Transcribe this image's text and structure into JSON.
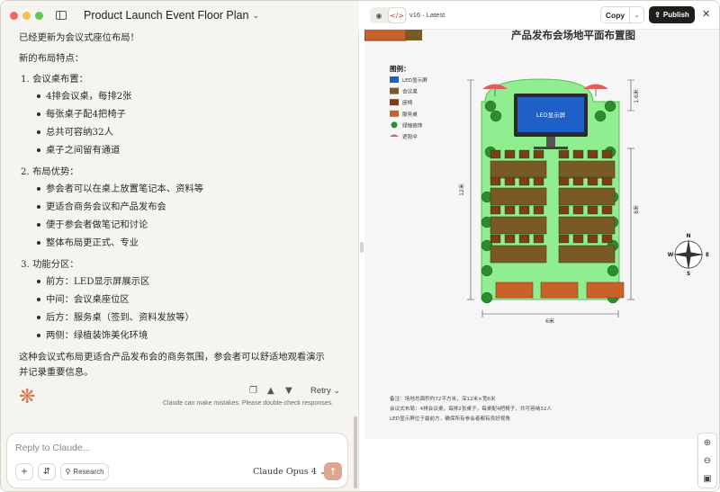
{
  "window": {
    "conversation_title": "Product Launch Event Floor Plan"
  },
  "chat": {
    "lead": "已经更新为会议式座位布局！",
    "subheading": "新的布局特点：",
    "sections": [
      {
        "title": "1. 会议桌布置：",
        "items": [
          "4排会议桌，每排2张",
          "每张桌子配4把椅子",
          "总共可容纳32人",
          "桌子之间留有通道"
        ]
      },
      {
        "title": "2. 布局优势：",
        "items": [
          "参会者可以在桌上放置笔记本、资料等",
          "更适合商务会议和产品发布会",
          "便于参会者做笔记和讨论",
          "整体布局更正式、专业"
        ]
      },
      {
        "title": "3. 功能分区：",
        "items": [
          "前方：LED显示屏展示区",
          "中间：会议桌座位区",
          "后方：服务桌（签到、资料发放等）",
          "两侧：绿植装饰美化环境"
        ]
      }
    ],
    "summary": "这种会议式布局更适合产品发布会的商务氛围，参会者可以舒适地观看演示并记录重要信息。",
    "retry_label": "Retry",
    "disclaimer": "Claude can make mistakes. Please double-check responses."
  },
  "input": {
    "placeholder": "Reply to Claude...",
    "research_label": "Research",
    "model_label": "Claude Opus 4"
  },
  "artifact": {
    "version_label": "v16 · Latest",
    "copy_label": "Copy",
    "publish_label": "Publish",
    "floor_plan": {
      "title": "产品发布会场地平面布置图",
      "legend_title": "图例：",
      "legend": [
        {
          "label": "LED显示屏",
          "color": "#1f5fc8",
          "shape": "rect"
        },
        {
          "label": "会议桌",
          "color": "#7a5a24",
          "shape": "rect"
        },
        {
          "label": "座椅",
          "color": "#7a3e1c",
          "shape": "rect"
        },
        {
          "label": "服务桌",
          "color": "#c8622a",
          "shape": "rect"
        },
        {
          "label": "绿植装饰",
          "color": "#2e8b2e",
          "shape": "circle"
        },
        {
          "label": "遮阳伞",
          "color": "#e25c5c",
          "shape": "umbrella"
        }
      ],
      "led_label": "LED显示屏",
      "dim_height_total": "12米",
      "dim_width": "6米",
      "dim_top": "1.6米",
      "dim_mid": "8米",
      "compass": {
        "n": "N",
        "s": "S",
        "e": "E",
        "w": "W"
      },
      "notes": [
        "备注：场地总面积约72平方米，深12米×宽6米",
        "会议式布局：4排会议桌，每排2张桌子，每桌配4把椅子，共可容纳32人",
        "LED显示屏位于最前方，确保所有参会者都有良好视角"
      ],
      "colors": {
        "floor": "#90ee90",
        "led": "#1f5fc8",
        "led_frame": "#2b2b2b",
        "table": "#7a5a24",
        "chair": "#7a3e1c",
        "service": "#c8622a",
        "plant": "#2e8b2e",
        "umbrella": "#e25c5c"
      }
    }
  }
}
